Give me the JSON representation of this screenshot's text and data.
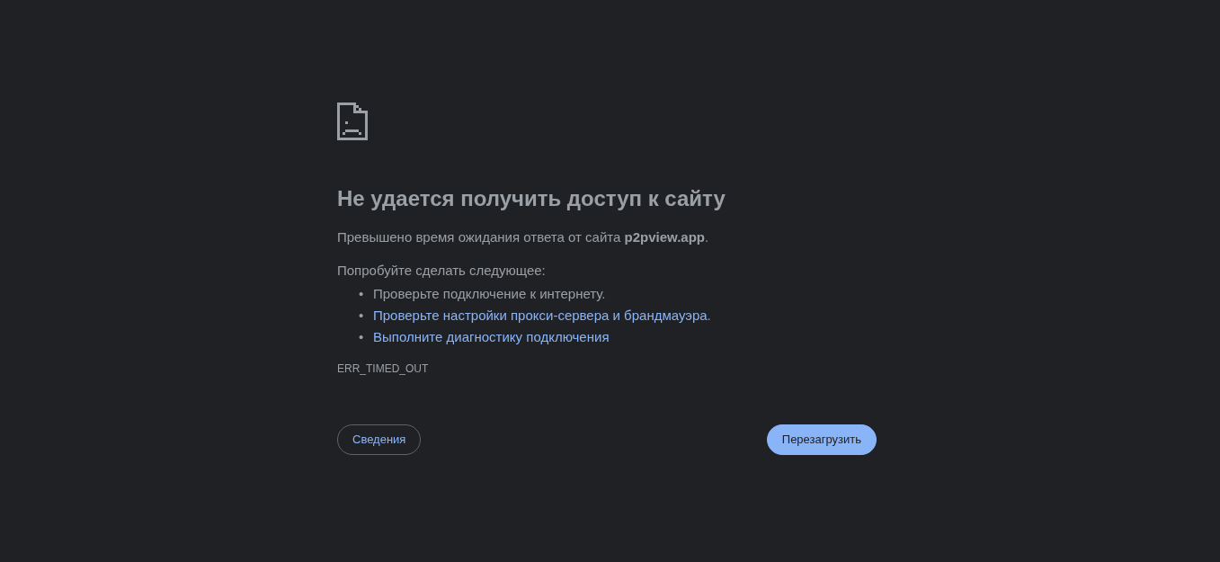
{
  "heading": "Не удается получить доступ к сайту",
  "summary": "Превышено время ожидания ответа от сайта **p2pview.app**.",
  "suggestions_intro": "Попробуйте сделать следующее:",
  "suggestions": [
    {
      "kind": "text",
      "marker": "•",
      "text": "Проверьте подключение к интернету."
    },
    {
      "kind": "link",
      "marker": "•",
      "text": "Проверьте настройки прокси-сервера и брандмауэра",
      "trailing": "."
    },
    {
      "kind": "link",
      "marker": "•",
      "text": "Выполните диагностику подключения"
    }
  ],
  "error_code": "ERR_TIMED_OUT",
  "buttons": [
    {
      "kind": "secondary",
      "label": "Сведения"
    },
    {
      "kind": "primary",
      "label": "Перезагрузить"
    }
  ]
}
